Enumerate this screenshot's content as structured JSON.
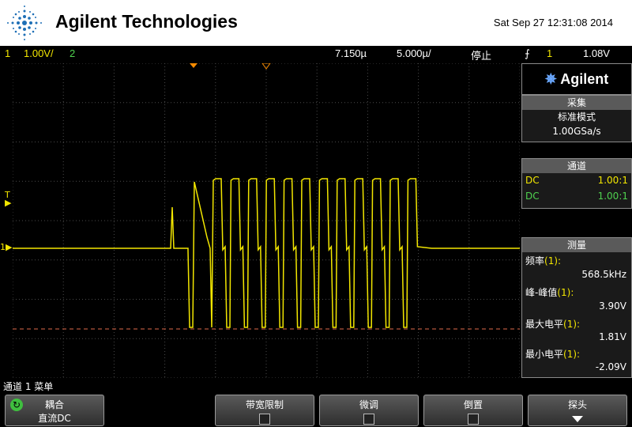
{
  "header": {
    "brand": "Agilent Technologies",
    "datetime": "Sat Sep 27 12:31:08 2014"
  },
  "status": {
    "ch1_label": "1",
    "ch1_scale": "1.00V/",
    "ch2_label": "2",
    "time_offset": "7.150µ",
    "time_scale": "5.000µ/",
    "run_state": "停止",
    "trigger_source": "1",
    "trigger_level": "1.08V"
  },
  "side": {
    "logo": "Agilent",
    "acq": {
      "title": "采集",
      "mode": "标准模式",
      "rate": "1.00GSa/s"
    },
    "channels": {
      "title": "通道",
      "rows": [
        {
          "coupling": "DC",
          "probe": "1.00:1"
        },
        {
          "coupling": "DC",
          "probe": "1.00:1"
        }
      ]
    },
    "measure": {
      "title": "测量",
      "items": [
        {
          "name": "频率",
          "ch": "(1):",
          "value": "568.5kHz"
        },
        {
          "name": "峰-峰值",
          "ch": "(1):",
          "value": "3.90V"
        },
        {
          "name": "最大电平",
          "ch": "(1):",
          "value": "1.81V"
        },
        {
          "name": "最小电平",
          "ch": "(1):",
          "value": "-2.09V"
        }
      ]
    }
  },
  "menu": {
    "title": "通道 1 菜单",
    "coupling": {
      "label": "耦合",
      "value": "直流DC"
    },
    "bw_limit": "带宽限制",
    "fine": "微调",
    "invert": "倒置",
    "probe": "探头"
  },
  "markers": {
    "ch1": "1",
    "trigger": "T"
  },
  "colors": {
    "ch1": "#f2e600",
    "ch2": "#4fd14f",
    "grid": "#4a4a4a",
    "cursor": "#e06a4a"
  },
  "waveform": {
    "baseline_v": 0.0,
    "high_v": 1.81,
    "low_v": -2.09,
    "pulse_count": 12
  }
}
